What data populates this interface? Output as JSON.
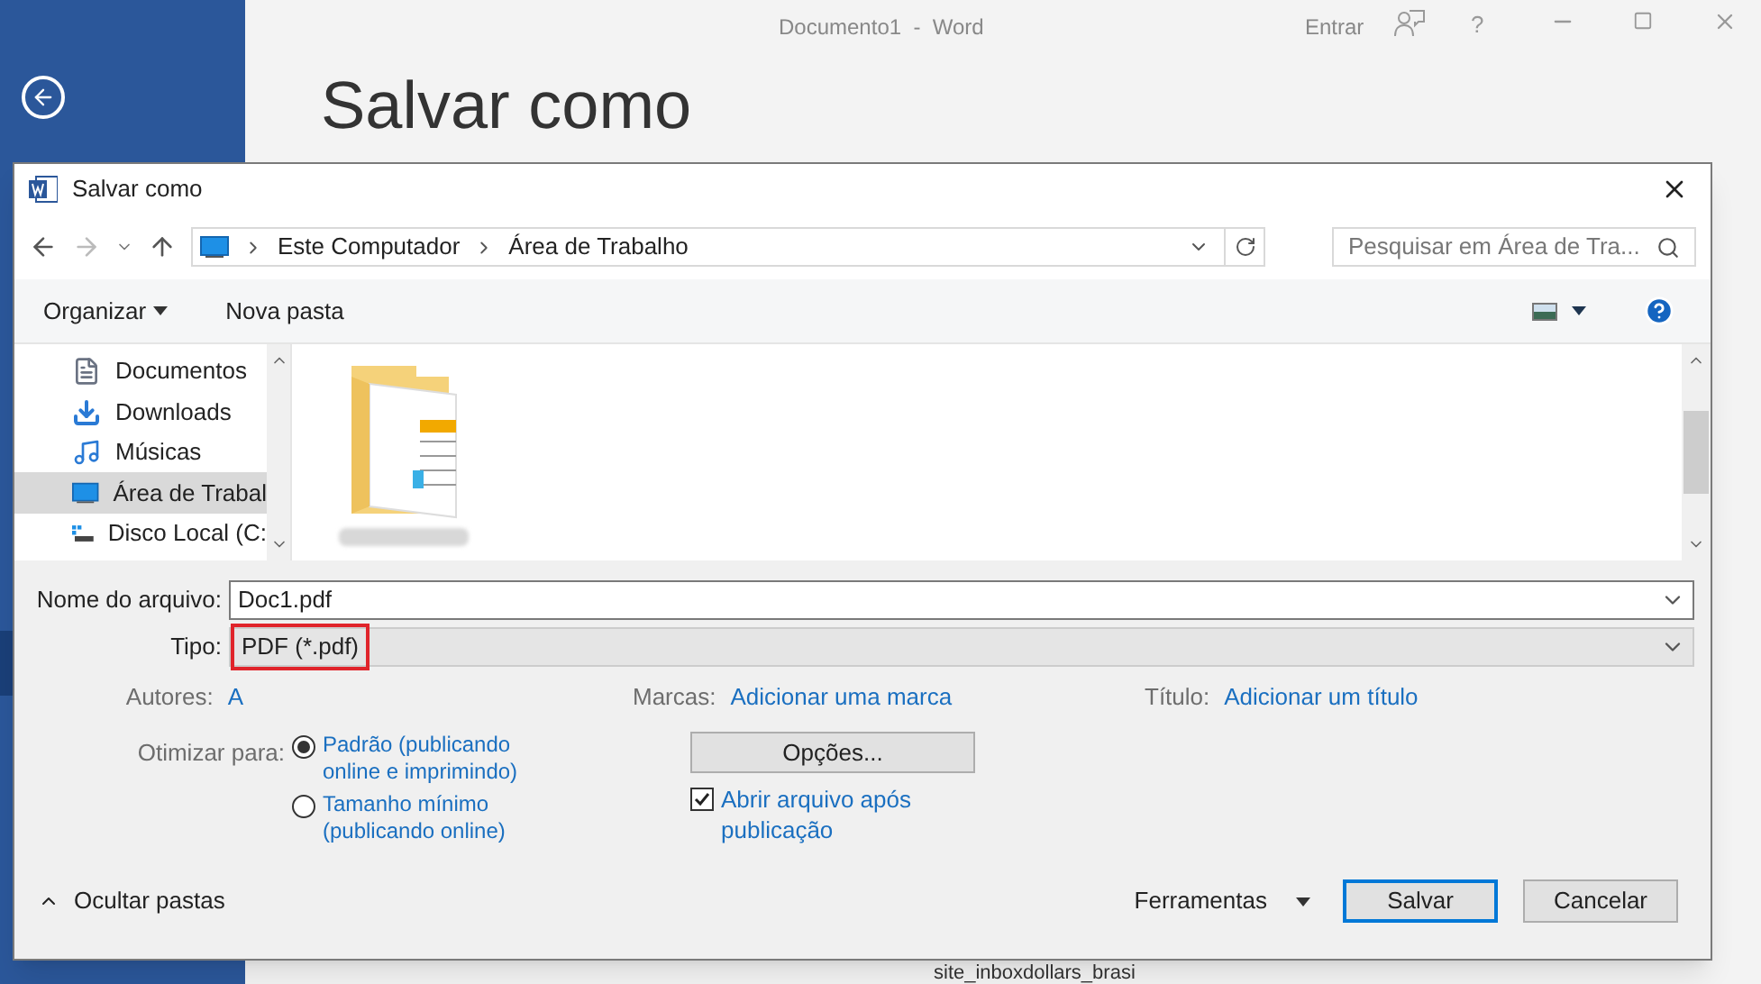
{
  "word": {
    "title": "Documento1  -  Word",
    "signin": "Entrar",
    "help": "?",
    "heading": "Salvar como",
    "behind_item": "site_inboxdollars_brasi"
  },
  "dialog": {
    "title": "Salvar como",
    "breadcrumb": [
      "Este Computador",
      "Área de Trabalho"
    ],
    "search": {
      "placeholder": "Pesquisar em Área de Tra..."
    },
    "toolbar": {
      "organize": "Organizar",
      "new_folder": "Nova pasta"
    },
    "nav_items": [
      {
        "kind": "documents",
        "label": "Documentos",
        "selected": false
      },
      {
        "kind": "downloads",
        "label": "Downloads",
        "selected": false
      },
      {
        "kind": "music",
        "label": "Músicas",
        "selected": false
      },
      {
        "kind": "desktop",
        "label": "Área de Trabal",
        "selected": true
      },
      {
        "kind": "drive",
        "label": "Disco Local (C:",
        "selected": false
      }
    ],
    "files": [
      {
        "kind": "folder"
      }
    ],
    "filename": {
      "label": "Nome do arquivo:",
      "value": "Doc1.pdf"
    },
    "type": {
      "label": "Tipo:",
      "value": "PDF (*.pdf)",
      "highlighted": true
    },
    "meta": [
      {
        "label": "Autores:",
        "value": "A"
      },
      {
        "label": "Marcas:",
        "value": "Adicionar uma marca"
      },
      {
        "label": "Título:",
        "value": "Adicionar um título"
      }
    ],
    "optimize": {
      "label": "Otimizar para:",
      "options": [
        {
          "label": "Padrão (publicando online e imprimindo)",
          "selected": true
        },
        {
          "label": "Tamanho mínimo (publicando online)",
          "selected": false
        }
      ]
    },
    "options_button": "Opções...",
    "open_after": {
      "label": "Abrir arquivo após publicação",
      "checked": true
    },
    "hide_folders": "Ocultar pastas",
    "tools": "Ferramentas",
    "save": "Salvar",
    "cancel": "Cancelar"
  }
}
